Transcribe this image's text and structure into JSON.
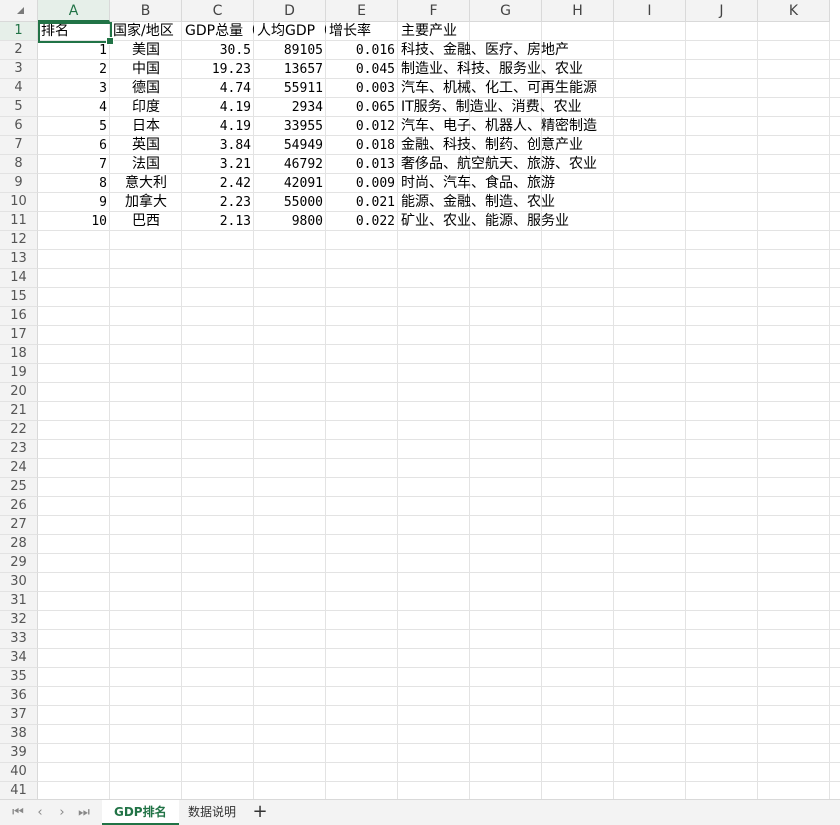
{
  "columns": [
    "A",
    "B",
    "C",
    "D",
    "E",
    "F",
    "G",
    "H",
    "I",
    "J",
    "K"
  ],
  "row_numbers": [
    "1",
    "2",
    "3",
    "4",
    "5",
    "6",
    "7",
    "8",
    "9",
    "10",
    "11",
    "12",
    "13",
    "14",
    "15",
    "16",
    "17",
    "18",
    "19",
    "20",
    "21",
    "22",
    "23",
    "24",
    "25",
    "26",
    "27",
    "28",
    "29",
    "30",
    "31",
    "32",
    "33",
    "34",
    "35",
    "36",
    "37",
    "38",
    "39",
    "40",
    "41"
  ],
  "header_row": [
    "排名",
    "国家/地区",
    "GDP总量（",
    "人均GDP（",
    "增长率",
    "主要产业"
  ],
  "rows": [
    [
      "1",
      "美国",
      "30.5",
      "89105",
      "0.016",
      "科技、金融、医疗、房地产"
    ],
    [
      "2",
      "中国",
      "19.23",
      "13657",
      "0.045",
      "制造业、科技、服务业、农业"
    ],
    [
      "3",
      "德国",
      "4.74",
      "55911",
      "0.003",
      "汽车、机械、化工、可再生能源"
    ],
    [
      "4",
      "印度",
      "4.19",
      "2934",
      "0.065",
      "IT服务、制造业、消费、农业"
    ],
    [
      "5",
      "日本",
      "4.19",
      "33955",
      "0.012",
      "汽车、电子、机器人、精密制造"
    ],
    [
      "6",
      "英国",
      "3.84",
      "54949",
      "0.018",
      "金融、科技、制药、创意产业"
    ],
    [
      "7",
      "法国",
      "3.21",
      "46792",
      "0.013",
      "奢侈品、航空航天、旅游、农业"
    ],
    [
      "8",
      "意大利",
      "2.42",
      "42091",
      "0.009",
      "时尚、汽车、食品、旅游"
    ],
    [
      "9",
      "加拿大",
      "2.23",
      "55000",
      "0.021",
      "能源、金融、制造、农业"
    ],
    [
      "10",
      "巴西",
      "2.13",
      "9800",
      "0.022",
      "矿业、农业、能源、服务业"
    ]
  ],
  "selected_cell": "A1",
  "sheet_tabs": [
    "GDP排名",
    "数据说明"
  ],
  "active_tab": "GDP排名",
  "add_tab_label": "+",
  "nav_buttons": [
    "⏮",
    "‹",
    "›",
    "⏭"
  ],
  "accent_color": "#217346"
}
